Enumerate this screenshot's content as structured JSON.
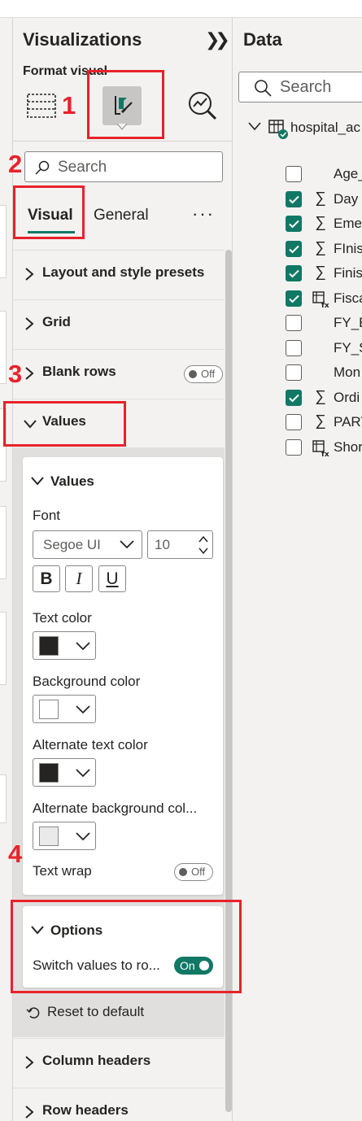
{
  "visualizations": {
    "title": "Visualizations",
    "format_label": "Format visual",
    "search_placeholder": "Search",
    "tabs": {
      "visual": "Visual",
      "general": "General",
      "more": "···"
    },
    "sections": {
      "layout": "Layout and style presets",
      "grid": "Grid",
      "blank_rows": "Blank rows",
      "blank_rows_toggle": "Off",
      "values": "Values",
      "column_headers": "Column headers",
      "row_headers": "Row headers"
    },
    "values_card": {
      "title": "Values",
      "font_label": "Font",
      "font_family": "Segoe UI",
      "font_size": "10",
      "bold": "B",
      "italic": "I",
      "underline": "U",
      "text_color_label": "Text color",
      "text_color": "#252423",
      "background_color_label": "Background color",
      "background_color": "#ffffff",
      "alt_text_color_label": "Alternate text color",
      "alt_text_color": "#252423",
      "alt_bg_color_label": "Alternate background col...",
      "alt_bg_color": "#eaeaea",
      "text_wrap_label": "Text wrap",
      "text_wrap_toggle": "Off"
    },
    "options_card": {
      "title": "Options",
      "switch_label": "Switch values to ro...",
      "switch_toggle": "On"
    },
    "reset_label": "Reset to default"
  },
  "annotations": {
    "n1": "1",
    "n2": "2",
    "n3": "3",
    "n4": "4",
    "color": "#e8222b"
  },
  "data_pane": {
    "title": "Data",
    "search_placeholder": "Search",
    "table_name": "hospital_ac",
    "fields": [
      {
        "name": "Age_",
        "checked": false,
        "type": ""
      },
      {
        "name": "Day",
        "checked": true,
        "type": "sigma"
      },
      {
        "name": "Emer",
        "checked": true,
        "type": "sigma"
      },
      {
        "name": "FInis",
        "checked": true,
        "type": "sigma"
      },
      {
        "name": "Finis",
        "checked": true,
        "type": "sigma"
      },
      {
        "name": "Fisca",
        "checked": true,
        "type": "calc"
      },
      {
        "name": "FY_E",
        "checked": false,
        "type": ""
      },
      {
        "name": "FY_S",
        "checked": false,
        "type": ""
      },
      {
        "name": "Mon",
        "checked": false,
        "type": ""
      },
      {
        "name": "Ordi",
        "checked": true,
        "type": "sigma"
      },
      {
        "name": "PART",
        "checked": false,
        "type": "sigma"
      },
      {
        "name": "Shor",
        "checked": false,
        "type": "calc"
      }
    ]
  },
  "colors": {
    "accent": "#117865",
    "pane": "#f3f2f1",
    "annotation": "#e8222b"
  }
}
